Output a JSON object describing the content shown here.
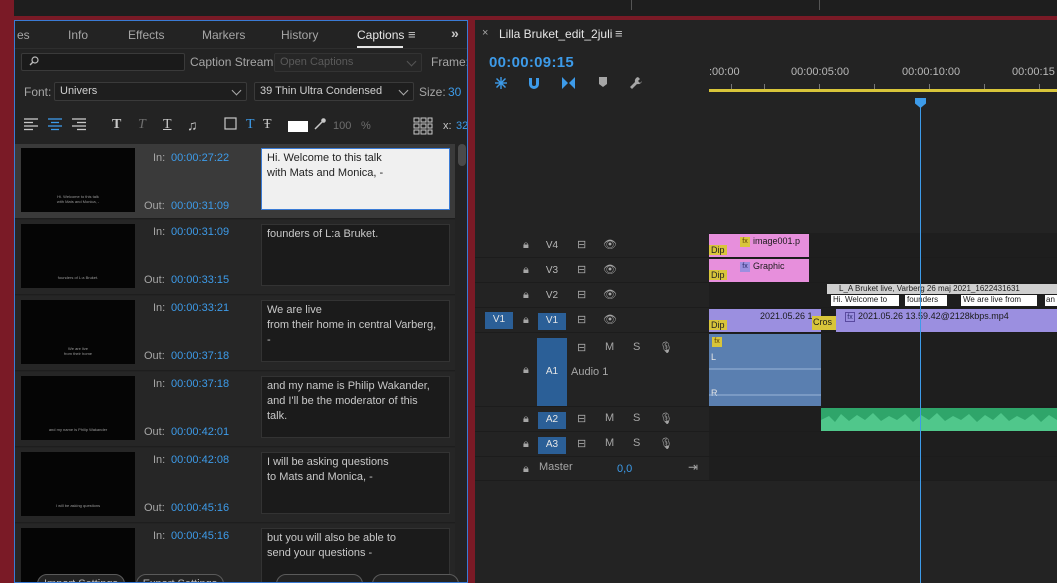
{
  "captions_panel": {
    "tabs": [
      "es",
      "Info",
      "Effects",
      "Markers",
      "History",
      "Captions"
    ],
    "active_tab": "Captions",
    "search": {
      "placeholder": ""
    },
    "caption_stream_label": "Caption Stream:",
    "caption_stream_value": "Open Captions",
    "frame_label": "Frame:",
    "font_label": "Font:",
    "font_value": "Univers",
    "font_style_value": "39 Thin Ultra Condensed",
    "size_label": "Size:",
    "size_value": "30",
    "opacity_value": "100",
    "opacity_unit": "%",
    "x_label": "x:",
    "x_value": "32",
    "in_label": "In:",
    "out_label": "Out:",
    "rows": [
      {
        "in": "00:00:27:22",
        "out": "00:00:31:09",
        "text": "Hi. Welcome to this talk\nwith Mats and Monica, -",
        "thumb": "Hi. Welcome to this talk\nwith Mats and Monica, -"
      },
      {
        "in": "00:00:31:09",
        "out": "00:00:33:15",
        "text": "founders of L:a Bruket.",
        "thumb": "founders of L:a Bruket."
      },
      {
        "in": "00:00:33:21",
        "out": "00:00:37:18",
        "text": "We are live\nfrom their home in central Varberg,\n-",
        "thumb": "We are live\nfrom their home"
      },
      {
        "in": "00:00:37:18",
        "out": "00:00:42:01",
        "text": "and my name is Philip Wakander,\nand I'll be the moderator of this\ntalk.",
        "thumb": "and my name is Philip Wakander"
      },
      {
        "in": "00:00:42:08",
        "out": "00:00:45:16",
        "text": "I will be asking questions\nto Mats and Monica, -",
        "thumb": "I will be asking questions"
      },
      {
        "in": "00:00:45:16",
        "out": "",
        "text": "but you will also be able to\nsend your questions -",
        "thumb": ""
      }
    ],
    "import_settings": "Import Settings",
    "export_settings": "Export Settings"
  },
  "timeline": {
    "sequence_title": "Lilla Bruket_edit_2juli",
    "playhead_timecode": "00:00:09:15",
    "ruler_labels": [
      ":00:00",
      "00:00:05:00",
      "00:00:10:00",
      "00:00:15"
    ],
    "tracks": {
      "v4": "V4",
      "v3": "V3",
      "v2": "V2",
      "v1": "V1",
      "v1_src": "V1",
      "a1": "A1",
      "a1_name": "Audio 1",
      "a2": "A2",
      "a3": "A3",
      "master": "Master",
      "master_value": "0,0"
    },
    "clips": {
      "image001": "image001.p",
      "graphic": "Graphic",
      "caption_header": "L_A Bruket live, Varberg 26 maj 2021_1622431631",
      "caption_1": "Hi. Welcome to",
      "caption_2": "founders",
      "caption_3": "We are live from",
      "caption_4": "an",
      "v1_clip_a": "2021.05.26 1",
      "v1_clip_b": "2021.05.26 13.59.42@2128kbps.mp4",
      "cross": "Cros",
      "dip": "Dip",
      "audio_l": "L",
      "audio_r": "R",
      "fx": "fx"
    },
    "msm": {
      "m": "M",
      "s": "S"
    }
  },
  "colors": {
    "accent_blue": "#3d9be9",
    "graphic_pink": "#e78fdc",
    "video_violet": "#9b8fe0",
    "audio_blue": "#5a7fb0",
    "audio_green": "#2fa56a",
    "caption_gray": "#cfcfcf",
    "dip_yellow": "#d8c53a"
  }
}
